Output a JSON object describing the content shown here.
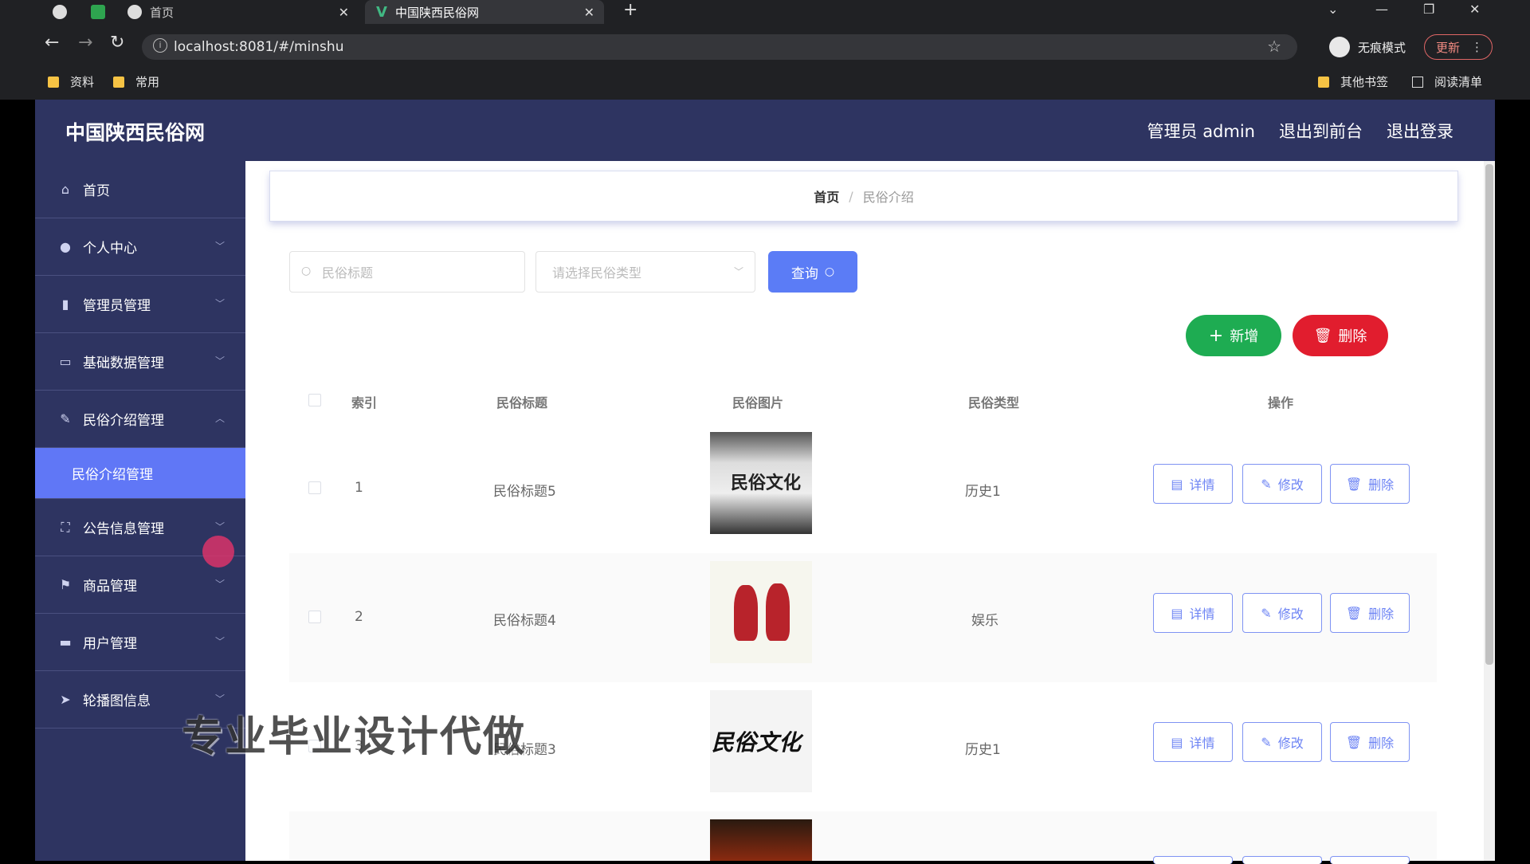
{
  "browser": {
    "tabs": [
      {
        "label": "首页"
      },
      {
        "label": "中国陕西民俗网"
      }
    ],
    "url": "localhost:8081/#/minshu",
    "incognito_label": "无痕模式",
    "update_label": "更新",
    "bookmarks": [
      "资料",
      "常用"
    ],
    "bookmarks_right": [
      "其他书签",
      "阅读清单"
    ]
  },
  "header": {
    "brand": "中国陕西民俗网",
    "admin": "管理员 admin",
    "to_front": "退出到前台",
    "logout": "退出登录"
  },
  "sidebar": {
    "items": [
      {
        "label": "首页",
        "icon": "home-icon"
      },
      {
        "label": "个人中心",
        "icon": "user-icon"
      },
      {
        "label": "管理员管理",
        "icon": "bar-chart-icon"
      },
      {
        "label": "基础数据管理",
        "icon": "card-icon"
      },
      {
        "label": "民俗介绍管理",
        "icon": "edit-icon"
      },
      {
        "label": "民俗介绍管理",
        "icon": ""
      },
      {
        "label": "公告信息管理",
        "icon": "fullscreen-icon"
      },
      {
        "label": "商品管理",
        "icon": "flag-icon"
      },
      {
        "label": "用户管理",
        "icon": "briefcase-icon"
      },
      {
        "label": "轮播图信息",
        "icon": "send-icon"
      }
    ]
  },
  "breadcrumb": {
    "home": "首页",
    "separator": "/",
    "current": "民俗介绍"
  },
  "search": {
    "title_placeholder": "民俗标题",
    "type_placeholder": "请选择民俗类型",
    "query_label": "查询"
  },
  "actions": {
    "add_label": "新增",
    "delete_label": "删除"
  },
  "table": {
    "headers": [
      "索引",
      "民俗标题",
      "民俗图片",
      "民俗类型",
      "操作"
    ],
    "rows": [
      {
        "index": "1",
        "title": "民俗标题5",
        "type": "历史1"
      },
      {
        "index": "2",
        "title": "民俗标题4",
        "type": "娱乐"
      },
      {
        "index": "3",
        "title": "民俗标题3",
        "type": "历史1"
      }
    ],
    "op_detail": "详情",
    "op_edit": "修改",
    "op_delete": "删除"
  },
  "watermark": "专业毕业设计代做",
  "colors": {
    "sidebar": "#2e3461",
    "active": "#6077f6",
    "primary": "#5b7cf6",
    "success": "#1eac52",
    "danger": "#e11d2e"
  }
}
